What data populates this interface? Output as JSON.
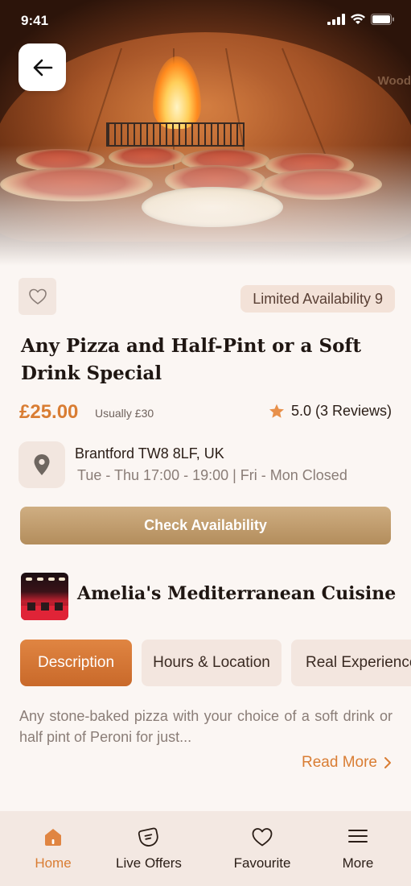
{
  "status_bar": {
    "time": "9:41"
  },
  "hero": {
    "oven_text": "Wood"
  },
  "deal": {
    "availability_badge": "Limited Availability 9",
    "title": "Any Pizza and Half-Pint or a Soft Drink Special",
    "price": "£25.00",
    "usual_price": "Usually £30",
    "rating": "5.0 (3 Reviews)",
    "address": "Brantford TW8 8LF, UK",
    "hours": "Tue - Thu 17:00 - 19:00 | Fri - Mon Closed",
    "check_button": "Check Availability"
  },
  "restaurant": {
    "name": "Amelia's Mediterranean Cuisine"
  },
  "tabs": [
    {
      "label": "Description"
    },
    {
      "label": "Hours & Location"
    },
    {
      "label": "Real Experience"
    }
  ],
  "description": {
    "text": "Any stone-baked pizza with your choice of a soft drink or half pint of Peroni for just...",
    "read_more": "Read More"
  },
  "bottom_nav": [
    {
      "label": "Home",
      "icon": "home-icon"
    },
    {
      "label": "Live Offers",
      "icon": "offers-icon"
    },
    {
      "label": "Favourite",
      "icon": "heart-icon"
    },
    {
      "label": "More",
      "icon": "menu-icon"
    }
  ],
  "colors": {
    "accent": "#d97d33",
    "button_gold": "#b38d5c",
    "background": "#fbf6f3",
    "chip": "#f3e6df"
  }
}
